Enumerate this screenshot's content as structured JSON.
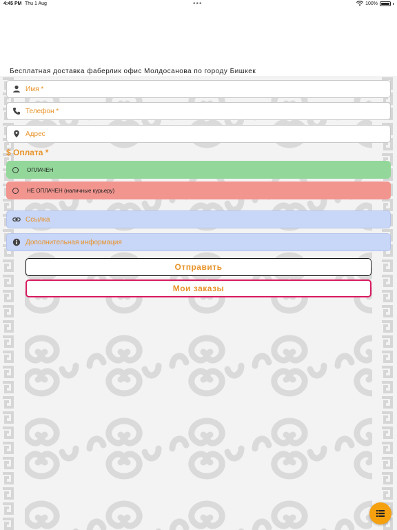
{
  "status_bar": {
    "time": "4:45 PM",
    "date": "Thu 1 Aug",
    "dots": "•••",
    "battery": "100%"
  },
  "header": {
    "text": "Бесплатная доставка фаберлик офис Молдосанова по городу Бишкек"
  },
  "form": {
    "name_placeholder": "Имя *",
    "phone_placeholder": "Телефон *",
    "address_placeholder": "Адрес",
    "payment_label": "$ Оплата *",
    "options": [
      {
        "label": "ОПЛАЧЕН",
        "color": "#93d89a"
      },
      {
        "label": "НЕ ОПЛАЧЕН (наличные курьеру)",
        "color": "#f2958f"
      }
    ],
    "link_placeholder": "Ссылка",
    "info_placeholder": "Дополнительная информация"
  },
  "buttons": {
    "send": "Отправить",
    "orders": "Мои заказы"
  },
  "colors": {
    "accent": "#e8932a",
    "fab": "#f5a00f",
    "orders_border": "#d81b60",
    "blue_field": "#c8d6f7"
  },
  "fab": {
    "icon": "list-icon"
  }
}
